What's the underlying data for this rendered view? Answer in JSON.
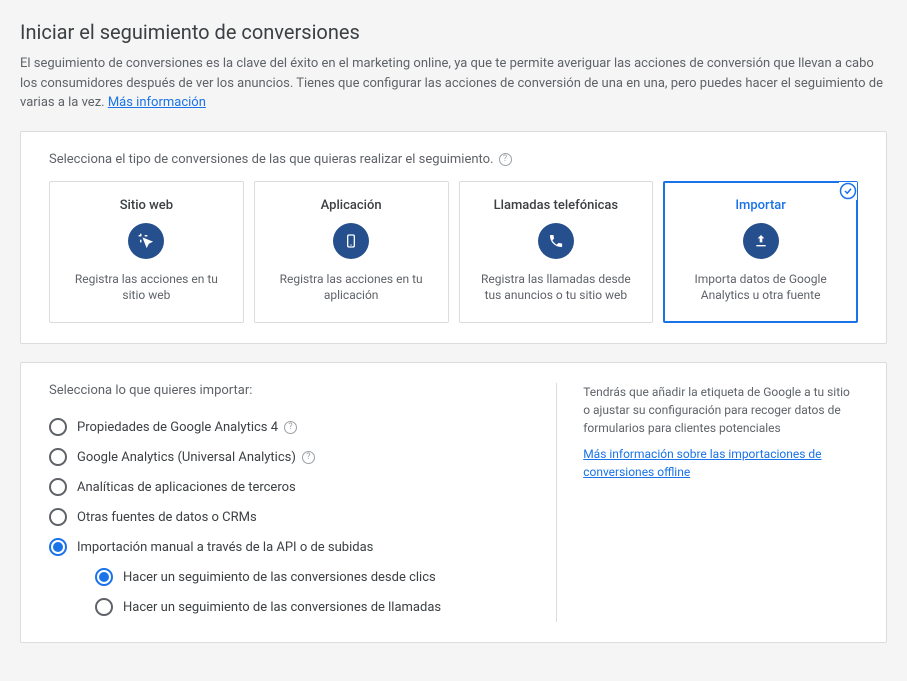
{
  "header": {
    "title": "Iniciar el seguimiento de conversiones",
    "description": "El seguimiento de conversiones es la clave del éxito en el marketing online, ya que te permite averiguar las acciones de conversión que llevan a cabo los consumidores después de ver los anuncios. Tienes que configurar las acciones de conversión de una en una, pero puedes hacer el seguimiento de varias a la vez.",
    "more_info": "Más información"
  },
  "type_section": {
    "label": "Selecciona el tipo de conversiones de las que quieras realizar el seguimiento.",
    "cards": [
      {
        "title": "Sitio web",
        "desc": "Registra las acciones en tu sitio web"
      },
      {
        "title": "Aplicación",
        "desc": "Registra las acciones en tu aplicación"
      },
      {
        "title": "Llamadas telefónicas",
        "desc": "Registra las llamadas desde tus anuncios o tu sitio web"
      },
      {
        "title": "Importar",
        "desc": "Importa datos de Google Analytics u otra fuente"
      }
    ]
  },
  "import_section": {
    "label": "Selecciona lo que quieres importar:",
    "options": [
      {
        "label": "Propiedades de Google Analytics 4",
        "help": true
      },
      {
        "label": "Google Analytics (Universal Analytics)",
        "help": true
      },
      {
        "label": "Analíticas de aplicaciones de terceros",
        "help": false
      },
      {
        "label": "Otras fuentes de datos o CRMs",
        "help": false
      },
      {
        "label": "Importación manual a través de la API o de subidas",
        "help": false
      }
    ],
    "sub_options": [
      {
        "label": "Hacer un seguimiento de las conversiones desde clics"
      },
      {
        "label": "Hacer un seguimiento de las conversiones de llamadas"
      }
    ],
    "info_text": "Tendrás que añadir la etiqueta de Google a tu sitio o ajustar su configuración para recoger datos de formularios para clientes potenciales",
    "info_link": "Más información sobre las importaciones de conversiones offline"
  }
}
